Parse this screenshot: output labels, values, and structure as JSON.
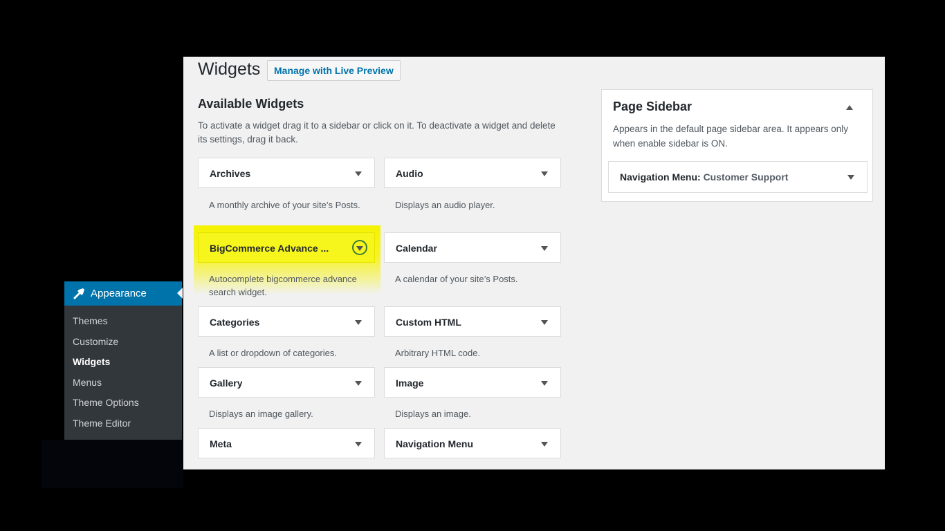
{
  "admin_menu": {
    "section_label": "Appearance",
    "section_icon": "paintbrush-icon",
    "items": [
      {
        "label": "Themes"
      },
      {
        "label": "Customize"
      },
      {
        "label": "Widgets",
        "current": true
      },
      {
        "label": "Menus"
      },
      {
        "label": "Theme Options"
      },
      {
        "label": "Theme Editor"
      }
    ]
  },
  "header": {
    "title": "Widgets",
    "live_preview_button": "Manage with Live Preview"
  },
  "available": {
    "title": "Available Widgets",
    "description": "To activate a widget drag it to a sidebar or click on it. To deactivate a widget and delete its settings, drag it back.",
    "widgets": [
      {
        "title": "Archives",
        "description": "A monthly archive of your site’s Posts."
      },
      {
        "title": "Audio",
        "description": "Displays an audio player."
      },
      {
        "title": "BigCommerce Advance ...",
        "description": "Autocomplete bigcommerce advance search widget.",
        "highlighted": true
      },
      {
        "title": "Calendar",
        "description": "A calendar of your site’s Posts."
      },
      {
        "title": "Categories",
        "description": "A list or dropdown of categories."
      },
      {
        "title": "Custom HTML",
        "description": "Arbitrary HTML code."
      },
      {
        "title": "Gallery",
        "description": "Displays an image gallery."
      },
      {
        "title": "Image",
        "description": "Displays an image."
      },
      {
        "title": "Meta",
        "description": ""
      },
      {
        "title": "Navigation Menu",
        "description": ""
      }
    ]
  },
  "sidebar_area": {
    "title": "Page Sidebar",
    "description": "Appears in the default page sidebar area. It appears only when enable sidebar is ON.",
    "widget_label": "Navigation Menu:",
    "widget_name": "Customer Support"
  },
  "colors": {
    "accent": "#0073aa",
    "highlight": "#f5f300",
    "menu_bg": "#32373c"
  }
}
